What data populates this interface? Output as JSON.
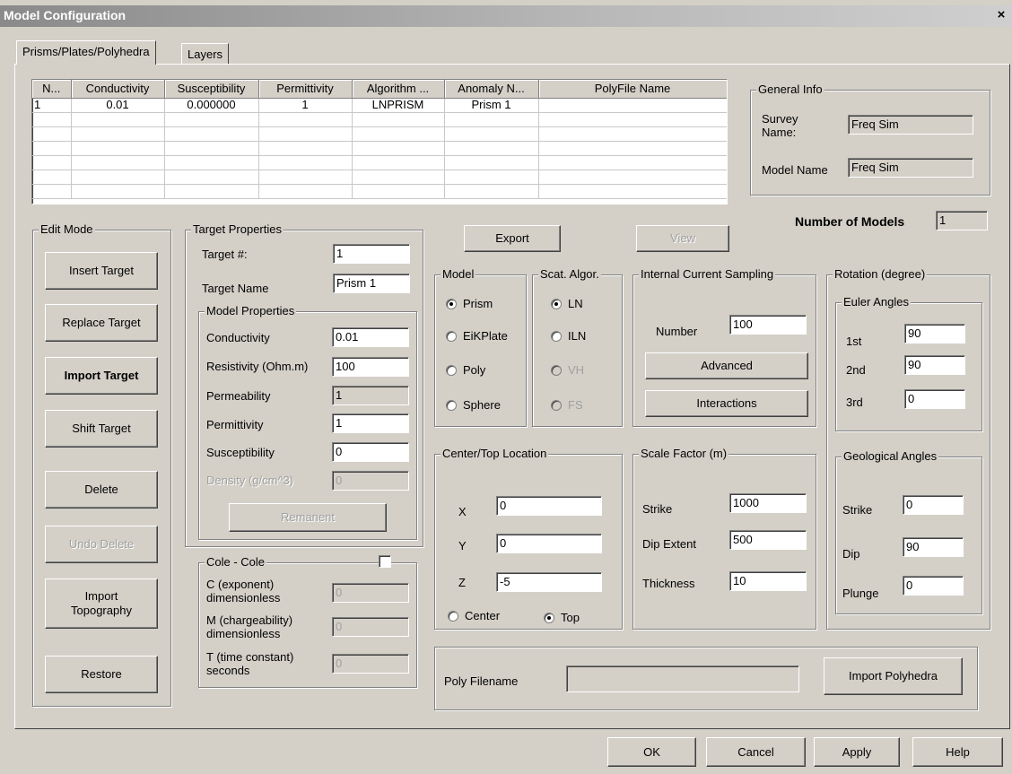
{
  "window": {
    "title": "Model Configuration",
    "close_glyph": "×"
  },
  "tabs": [
    {
      "label": "Prisms/Plates/Polyhedra"
    },
    {
      "label": "Layers"
    }
  ],
  "table": {
    "columns": [
      "N...",
      "Conductivity",
      "Susceptibility",
      "Permittivity",
      "Algorithm ...",
      "Anomaly N...",
      "PolyFile Name"
    ],
    "rows": [
      [
        "1",
        "0.01",
        "0.000000",
        "1",
        "LNPRISM",
        "Prism 1",
        ""
      ]
    ]
  },
  "general_info": {
    "label": "General Info",
    "survey_name_label": "Survey\nName:",
    "survey_name": "Freq Sim",
    "model_name_label": "Model Name",
    "model_name": "Freq Sim"
  },
  "number_of_models": {
    "label": "Number of Models",
    "value": "1"
  },
  "edit_mode": {
    "label": "Edit Mode",
    "insert": "Insert Target",
    "replace": "Replace Target",
    "import": "Import Target",
    "shift": "Shift Target",
    "delete": "Delete",
    "undo_delete": "Undo Delete",
    "import_topo": "Import\nTopography",
    "restore": "Restore"
  },
  "target_properties": {
    "label": "Target Properties",
    "target_num_label": "Target #:",
    "target_num": "1",
    "target_name_label": "Target Name",
    "target_name": "Prism 1"
  },
  "model_properties": {
    "label": "Model Properties",
    "conductivity_label": "Conductivity",
    "conductivity": "0.01",
    "resistivity_label": "Resistivity (Ohm.m)",
    "resistivity": "100",
    "permeability_label": "Permeability",
    "permeability": "1",
    "permittivity_label": "Permittivity",
    "permittivity": "1",
    "susceptibility_label": "Susceptibility",
    "susceptibility": "0",
    "density_label": "Density (g/cm^3)",
    "density": "0",
    "remanent": "Remanent"
  },
  "cole_cole": {
    "label": "Cole - Cole",
    "c_label": "C (exponent)\ndimensionless",
    "c": "0",
    "m_label": "M (chargeability)\ndimensionless",
    "m": "0",
    "t_label": "T (time constant)\nseconds",
    "t": "0"
  },
  "export": "Export",
  "view": "View",
  "model": {
    "label": "Model",
    "options": [
      "Prism",
      "EiKPlate",
      "Poly",
      "Sphere"
    ],
    "selected": "Prism"
  },
  "scat_algor": {
    "label": "Scat. Algor.",
    "options": [
      "LN",
      "ILN",
      "VH",
      "FS"
    ],
    "selected": "LN"
  },
  "internal_current": {
    "label": "Internal Current Sampling",
    "number_label": "Number",
    "number": "100",
    "advanced": "Advanced",
    "interactions": "Interactions"
  },
  "rotation": {
    "label": "Rotation (degree)",
    "euler_label": "Euler Angles",
    "first_label": "1st",
    "first": "90",
    "second_label": "2nd",
    "second": "90",
    "third_label": "3rd",
    "third": "0",
    "geo_label": "Geological Angles",
    "strike_label": "Strike",
    "strike": "0",
    "dip_label": "Dip",
    "dip": "90",
    "plunge_label": "Plunge",
    "plunge": "0"
  },
  "location": {
    "label": "Center/Top Location",
    "x_label": "X",
    "x": "0",
    "y_label": "Y",
    "y": "0",
    "z_label": "Z",
    "z": "-5",
    "center": "Center",
    "top": "Top",
    "selected": "Top"
  },
  "scale_factor": {
    "label": "Scale Factor (m)",
    "strike_label": "Strike",
    "strike": "1000",
    "dip_extent_label": "Dip Extent",
    "dip_extent": "500",
    "thickness_label": "Thickness",
    "thickness": "10"
  },
  "poly": {
    "filename_label": "Poly Filename",
    "filename": "",
    "import": "Import Polyhedra"
  },
  "footer": {
    "ok": "OK",
    "cancel": "Cancel",
    "apply": "Apply",
    "help": "Help"
  }
}
